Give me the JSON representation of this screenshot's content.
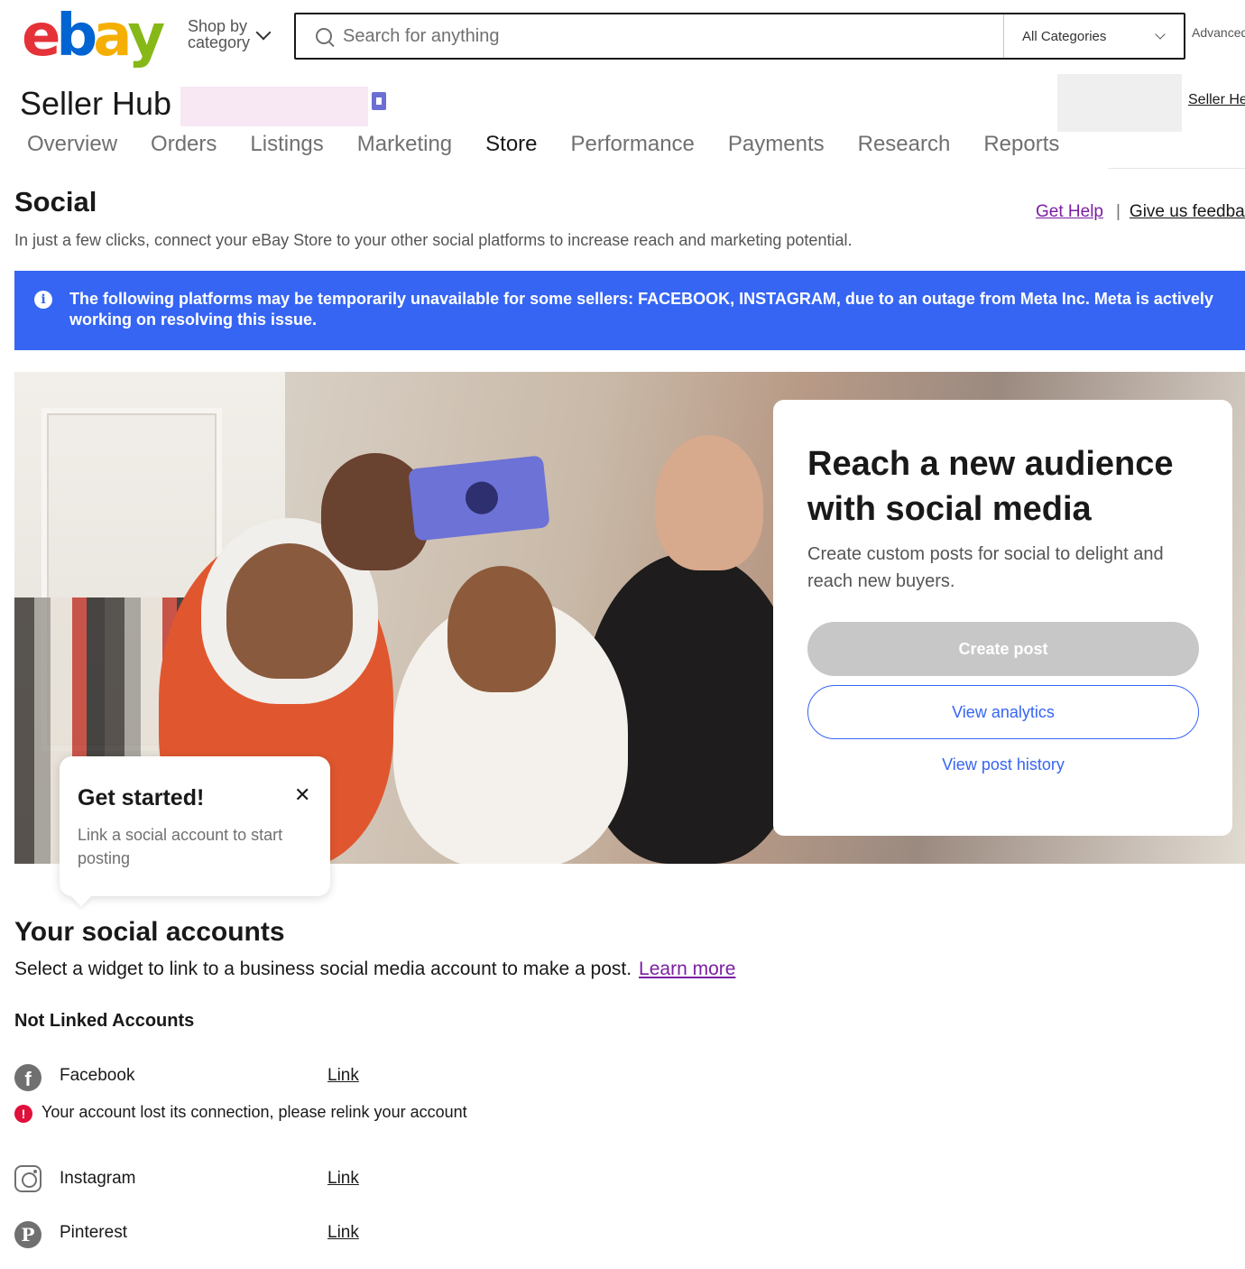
{
  "header": {
    "logo_letters": [
      "e",
      "b",
      "a",
      "y"
    ],
    "logo_colors": [
      "#e53238",
      "#0064d2",
      "#f5af02",
      "#86b817"
    ],
    "shop_by_line1": "Shop by",
    "shop_by_line2": "category",
    "search_placeholder": "Search for anything",
    "category": "All Categories",
    "advanced": "Advanced"
  },
  "seller_bar": {
    "title": "Seller Hub",
    "seller_link": "Seller Help"
  },
  "nav": {
    "items": [
      "Overview",
      "Orders",
      "Listings",
      "Marketing",
      "Store",
      "Performance",
      "Payments",
      "Research",
      "Reports"
    ],
    "active": "Store"
  },
  "page": {
    "title": "Social",
    "subtitle": "In just a few clicks, connect your eBay Store to your other social platforms to increase reach and marketing potential.",
    "get_help": "Get Help",
    "separator": "|",
    "feedback": "Give us feedback"
  },
  "banner": {
    "icon": "info-icon",
    "text": "The following platforms may be temporarily unavailable for some sellers: FACEBOOK, INSTAGRAM, due to an outage from Meta Inc. Meta is actively working on resolving this issue.",
    "color": "#3665f3"
  },
  "hero": {
    "title": "Reach a new audience with social media",
    "subtitle": "Create custom posts for social to delight and reach new buyers.",
    "create_post": "Create post",
    "view_analytics": "View analytics",
    "view_history": "View post history"
  },
  "tooltip": {
    "title": "Get started!",
    "close": "✕",
    "text": "Link a social account to start posting"
  },
  "social_accounts": {
    "title": "Your social accounts",
    "subtitle": "Select a widget to link to a business social media account to make a post.",
    "learn_more": "Learn more",
    "section_label": "Not Linked Accounts",
    "accounts": [
      {
        "name": "Facebook",
        "icon": "facebook-icon",
        "action": "Link",
        "error": "Your account lost its connection, please relink your account"
      },
      {
        "name": "Instagram",
        "icon": "instagram-icon",
        "action": "Link"
      },
      {
        "name": "Pinterest",
        "icon": "pinterest-icon",
        "action": "Link"
      }
    ]
  }
}
